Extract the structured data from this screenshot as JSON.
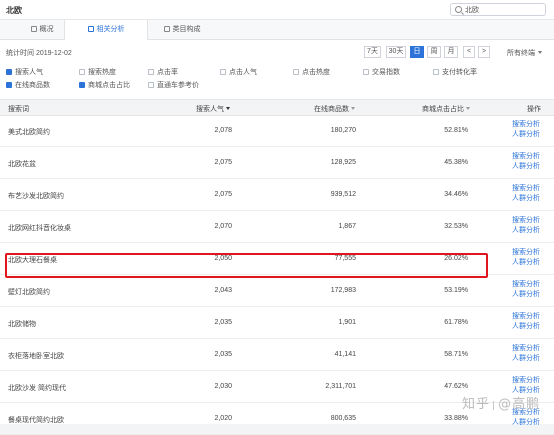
{
  "header": {
    "title": "北欧"
  },
  "search": {
    "value": "北欧"
  },
  "tabs": [
    {
      "label": "概况",
      "icon": "home-icon"
    },
    {
      "label": "相关分析",
      "icon": "home-icon"
    },
    {
      "label": "类目构成",
      "icon": "home-icon"
    }
  ],
  "datebar": {
    "stat_time": "统计时间 2019-12-02",
    "ranges": [
      "7天",
      "30天",
      "日",
      "周",
      "月"
    ],
    "active_range": "日",
    "prev": "<",
    "next": ">",
    "all_terminals": "所有终端"
  },
  "metrics": [
    {
      "label": "搜索人气",
      "checked": true
    },
    {
      "label": "搜索热度",
      "checked": false
    },
    {
      "label": "点击率",
      "checked": false
    },
    {
      "label": "点击人气",
      "checked": false
    },
    {
      "label": "点击热度",
      "checked": false
    },
    {
      "label": "交易指数",
      "checked": false
    },
    {
      "label": "支付转化率",
      "checked": false
    },
    {
      "label": "在线商品数",
      "checked": true
    },
    {
      "label": "商城点击占比",
      "checked": true
    },
    {
      "label": "直通车参考价",
      "checked": false
    }
  ],
  "table": {
    "columns": [
      "搜索词",
      "搜索人气",
      "在线商品数",
      "商城点击占比",
      "操作"
    ],
    "op_links": [
      "搜索分析",
      "人群分析"
    ],
    "rows": [
      {
        "term": "美式北欧简约",
        "popularity": "2,078",
        "products": "180,270",
        "ratio": "52.81%"
      },
      {
        "term": "北欧花盆",
        "popularity": "2,075",
        "products": "128,925",
        "ratio": "45.38%"
      },
      {
        "term": "布艺沙发北欧简约",
        "popularity": "2,075",
        "products": "939,512",
        "ratio": "34.46%"
      },
      {
        "term": "北欧网红抖音化妆桌",
        "popularity": "2,070",
        "products": "1,867",
        "ratio": "32.53%"
      },
      {
        "term": "北欧大理石餐桌",
        "popularity": "2,050",
        "products": "77,555",
        "ratio": "26.02%"
      },
      {
        "term": "壁灯北欧简约",
        "popularity": "2,043",
        "products": "172,983",
        "ratio": "53.19%"
      },
      {
        "term": "北欧储物",
        "popularity": "2,035",
        "products": "1,901",
        "ratio": "61.78%"
      },
      {
        "term": "衣柜落地卧室北欧",
        "popularity": "2,035",
        "products": "41,141",
        "ratio": "58.71%"
      },
      {
        "term": "北欧沙发 简约现代",
        "popularity": "2,030",
        "products": "2,311,701",
        "ratio": "47.62%"
      },
      {
        "term": "餐桌现代简约北欧",
        "popularity": "2,020",
        "products": "800,635",
        "ratio": "33.88%"
      }
    ]
  },
  "watermark": {
    "site": "知乎",
    "author": "@高鹏"
  },
  "colors": {
    "accent": "#2b73d9",
    "highlight": "#e0161e"
  }
}
